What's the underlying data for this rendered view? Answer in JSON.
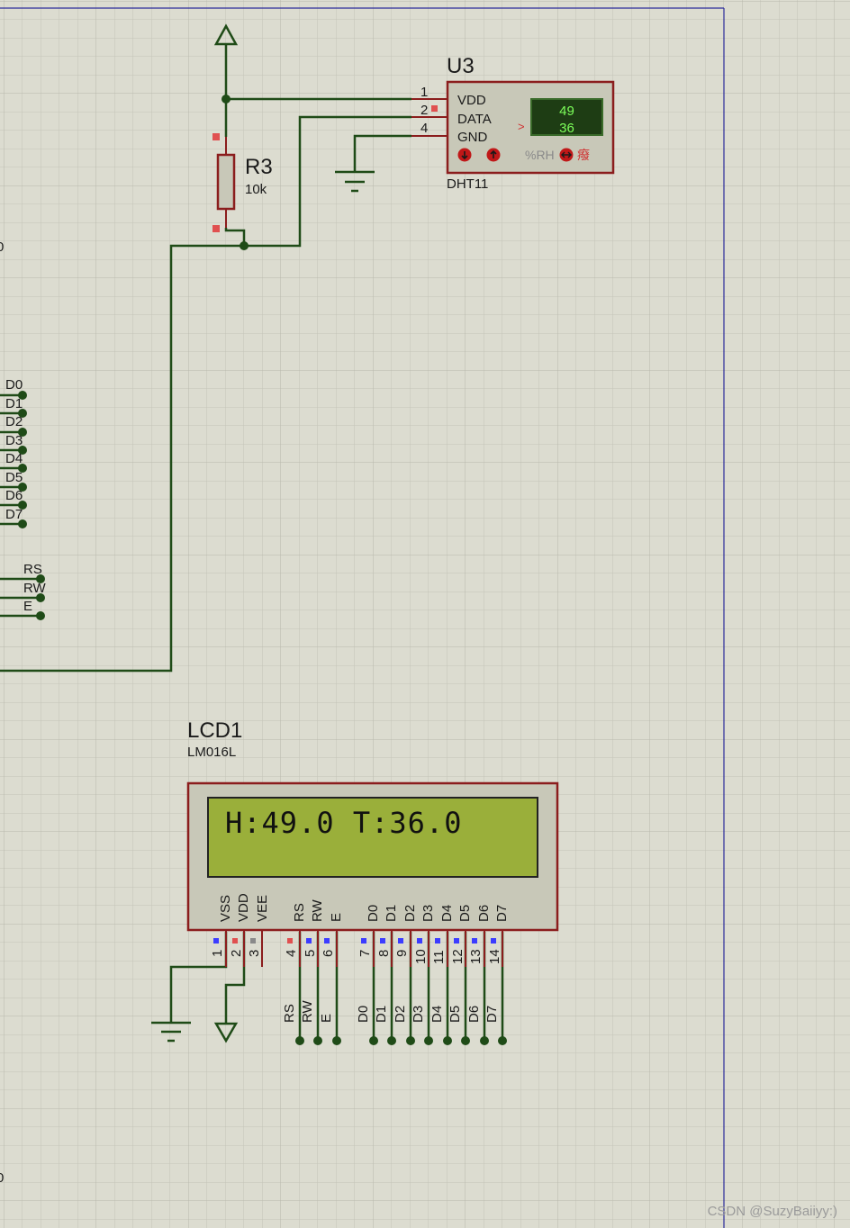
{
  "colors": {
    "background": "#dcdcd0",
    "grid": "#c7c7bb",
    "wire": "#1f4b17",
    "component_border": "#8b1d1d",
    "component_fill": "#c8c8b8",
    "lcd_screen": "#9aaf3a",
    "pin_red": "#e05050",
    "pin_blue": "#3c3cff",
    "frame": "#2b2b9a"
  },
  "left_edge": {
    "net_d_labels": [
      "D0",
      "D1",
      "D2",
      "D3",
      "D4",
      "D5",
      "D6",
      "D7"
    ],
    "net_ctrl_labels": [
      "RS",
      "RW",
      "E"
    ],
    "cut_top": "0",
    "cut_bottom": "0"
  },
  "u3": {
    "ref": "U3",
    "part": "DHT11",
    "pin_numbers": [
      "1",
      "2",
      "4"
    ],
    "pin_names": [
      "VDD",
      "DATA",
      "GND"
    ],
    "display": {
      "humidity": "49",
      "temperature": "36"
    },
    "arrow": ">",
    "unit_label": "%RH",
    "icons": [
      "decrease-icon",
      "increase-icon",
      "toggle-icon"
    ],
    "extra_glyph": "癈"
  },
  "r3": {
    "ref": "R3",
    "value": "10k"
  },
  "lcd1": {
    "ref": "LCD1",
    "part": "LM016L",
    "screen_text": "H:49.0 T:36.0",
    "pin_names": [
      "VSS",
      "VDD",
      "VEE",
      "RS",
      "RW",
      "E",
      "D0",
      "D1",
      "D2",
      "D3",
      "D4",
      "D5",
      "D6",
      "D7"
    ],
    "pin_numbers": [
      "1",
      "2",
      "3",
      "4",
      "5",
      "6",
      "7",
      "8",
      "9",
      "10",
      "11",
      "12",
      "13",
      "14"
    ],
    "net_labels": [
      "RS",
      "RW",
      "E",
      "D0",
      "D1",
      "D2",
      "D3",
      "D4",
      "D5",
      "D6",
      "D7"
    ]
  },
  "watermark": "CSDN @SuzyBaiiyy:)"
}
